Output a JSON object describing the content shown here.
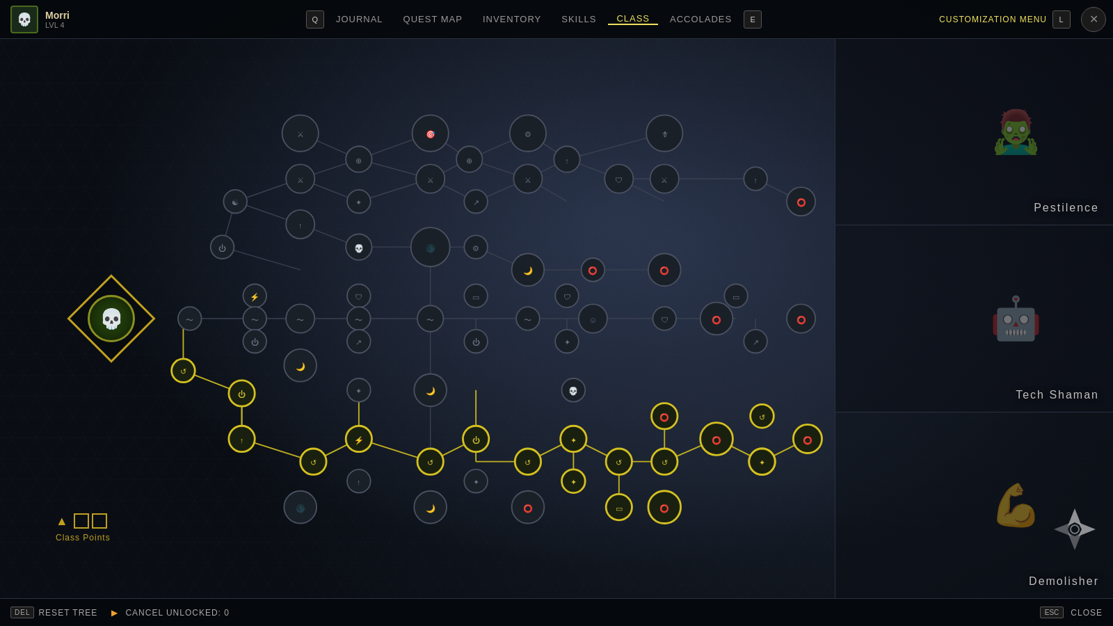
{
  "player": {
    "name": "Morri",
    "level": "LVL 4",
    "avatar_icon": "💀"
  },
  "nav": {
    "left_key": "Q",
    "right_key": "E",
    "items": [
      {
        "label": "JOURNAL",
        "active": false
      },
      {
        "label": "QUEST MAP",
        "active": false
      },
      {
        "label": "INVENTORY",
        "active": false
      },
      {
        "label": "SKILLS",
        "active": false
      },
      {
        "label": "CLASS",
        "active": true
      },
      {
        "label": "ACCOLADES",
        "active": false
      }
    ],
    "customization": "CUSTOMIZATION MENU",
    "customization_key": "L"
  },
  "classes": [
    {
      "name": "Pestilence",
      "figure": "🧟"
    },
    {
      "name": "Tech Shaman",
      "figure": "🤖"
    },
    {
      "name": "Demolisher",
      "figure": "💪"
    }
  ],
  "bottom": {
    "reset_key": "DEL",
    "reset_label": "RESET TREE",
    "cancel_label": "CANCEL UNLOCKED: 0",
    "close_key": "ESC",
    "close_label": "CLOSE"
  },
  "class_points": {
    "label": "Class Points"
  },
  "tree": {
    "active_color": "#d4c020",
    "inactive_color": "#4a5060"
  }
}
